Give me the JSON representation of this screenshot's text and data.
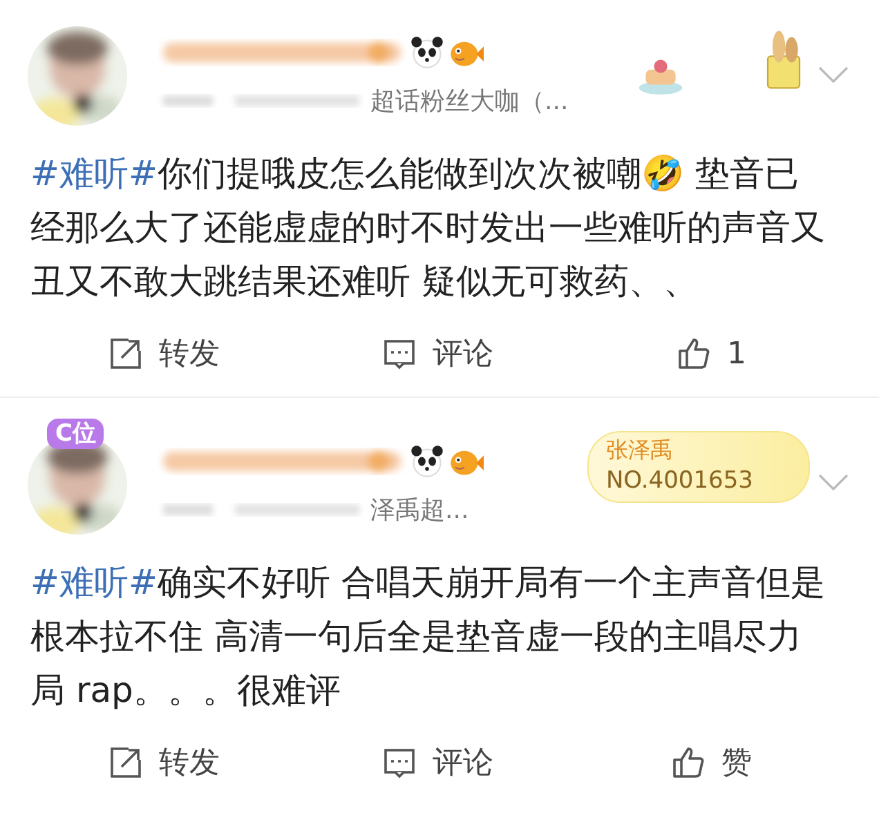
{
  "posts": [
    {
      "meta": "超话粉丝大咖（...",
      "hashtag": "#难听#",
      "text": "你们提哦皮怎么能做到次次被嘲🤣 垫音已经那么大了还能虚虚的时不时发出一些难听的声音又丑又不敢大跳结果还难听 疑似无可救药、、",
      "actions": [
        {
          "kind": "repost",
          "label": "转发"
        },
        {
          "kind": "comment",
          "label": "评论"
        },
        {
          "kind": "like",
          "label": "1"
        }
      ]
    },
    {
      "avatar_badge": "C位",
      "fan_badge": {
        "name": "张泽禹",
        "number": "NO.4001653"
      },
      "meta": "泽禹超...",
      "hashtag": "#难听#",
      "text": "确实不好听  合唱天崩开局有一个主声音但是根本拉不住 高清一句后全是垫音虚一段的主唱尽力局  rap。。。很难评",
      "actions": [
        {
          "kind": "repost",
          "label": "转发"
        },
        {
          "kind": "comment",
          "label": "评论"
        },
        {
          "kind": "like",
          "label": "赞"
        }
      ]
    }
  ]
}
